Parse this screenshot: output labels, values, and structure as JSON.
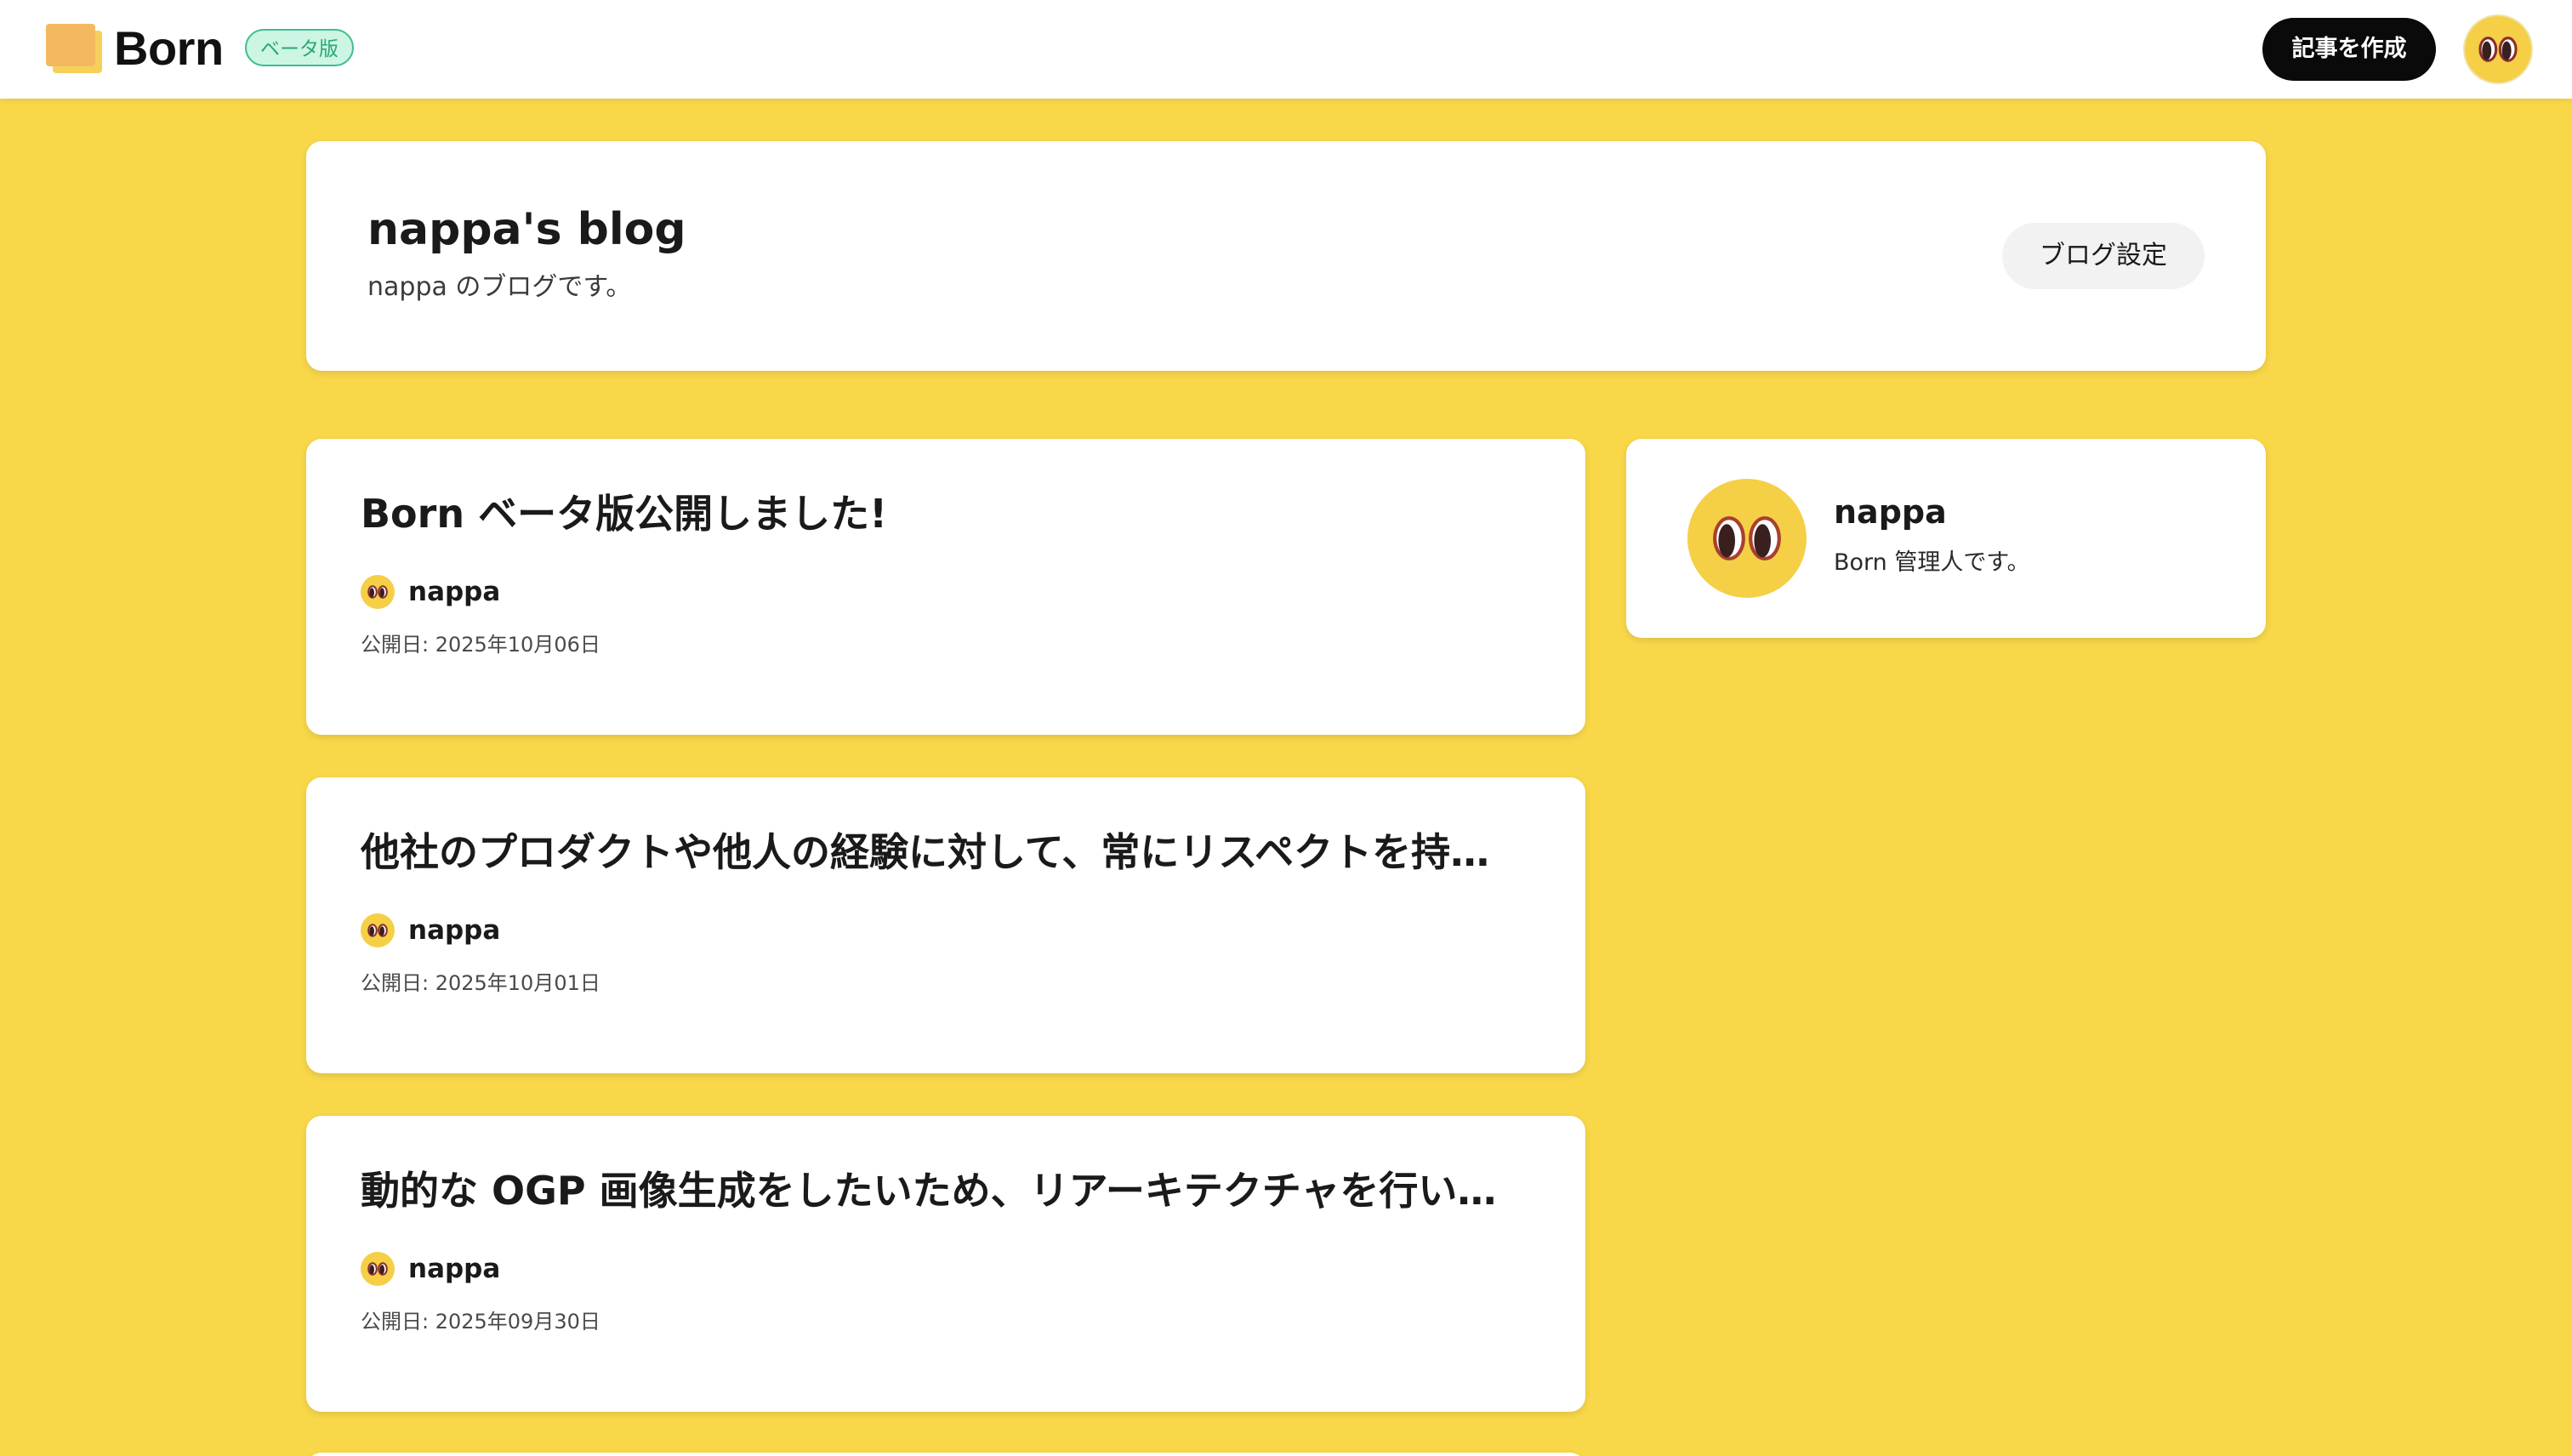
{
  "header": {
    "logo_text": "Born",
    "beta_badge": "ベータ版",
    "create_button": "記事を作成"
  },
  "blog": {
    "title": "nappa's blog",
    "description": "nappa のブログです。",
    "settings_button": "ブログ設定"
  },
  "articles": [
    {
      "title": "Born ベータ版公開しました!",
      "author": "nappa",
      "date": "公開日: 2025年10月06日"
    },
    {
      "title": "他社のプロダクトや他人の経験に対して、常にリスペクトを持…",
      "author": "nappa",
      "date": "公開日: 2025年10月01日"
    },
    {
      "title": "動的な OGP 画像生成をしたいため、リアーキテクチャを行い…",
      "author": "nappa",
      "date": "公開日: 2025年09月30日"
    }
  ],
  "profile": {
    "name": "nappa",
    "bio": "Born 管理人です。"
  },
  "colors": {
    "page_background": "#f8d749",
    "card_background": "#ffffff",
    "create_button_bg": "#0a0a0a",
    "beta_badge_bg": "#cdf5e3",
    "beta_badge_border": "#3dbf8c",
    "avatar_face": "#f5cf45"
  },
  "icons": {
    "avatar": "eyes-avatar-icon",
    "logo": "born-logo-icon"
  }
}
